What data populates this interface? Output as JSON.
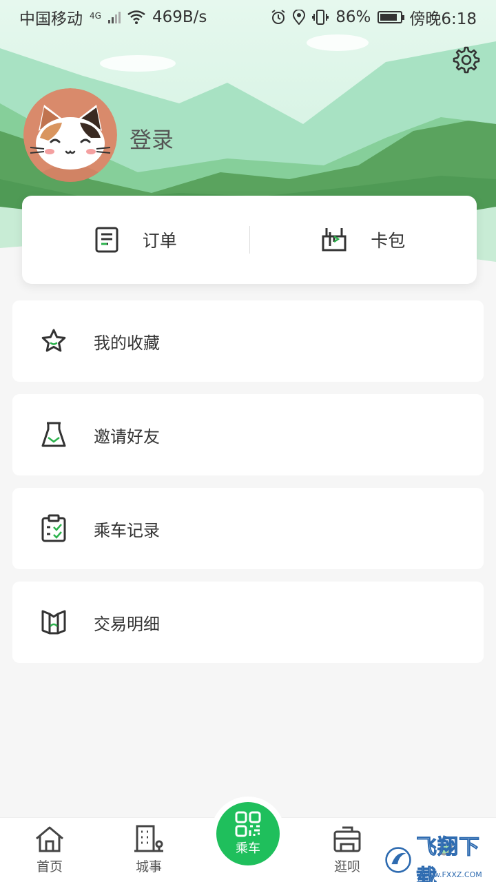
{
  "status_bar": {
    "carrier": "中国移动",
    "network": "4G",
    "speed": "469B/s",
    "battery": "86%",
    "battery_level": 0.86,
    "time": "傍晚6:18"
  },
  "profile": {
    "login_label": "登录"
  },
  "quick_actions": [
    {
      "label": "订单",
      "icon": "document-icon"
    },
    {
      "label": "卡包",
      "icon": "card-wallet-icon"
    }
  ],
  "menu": [
    {
      "label": "我的收藏",
      "icon": "star-icon"
    },
    {
      "label": "邀请好友",
      "icon": "invite-cup-icon"
    },
    {
      "label": "乘车记录",
      "icon": "clipboard-check-icon"
    },
    {
      "label": "交易明细",
      "icon": "book-icon"
    }
  ],
  "tabs": [
    {
      "label": "首页",
      "icon": "home-icon"
    },
    {
      "label": "城事",
      "icon": "building-icon"
    },
    {
      "label": "乘车",
      "icon": "qr-code-icon"
    },
    {
      "label": "逛呗",
      "icon": "shop-icon"
    }
  ],
  "watermark": {
    "text": "飞翔下载",
    "url": "www.FXXZ.COM"
  },
  "colors": {
    "accent": "#1fbf5c",
    "icon_green": "#2bb24c",
    "hero_light": "#bfe9d3",
    "hero_dark": "#5aa35e"
  }
}
